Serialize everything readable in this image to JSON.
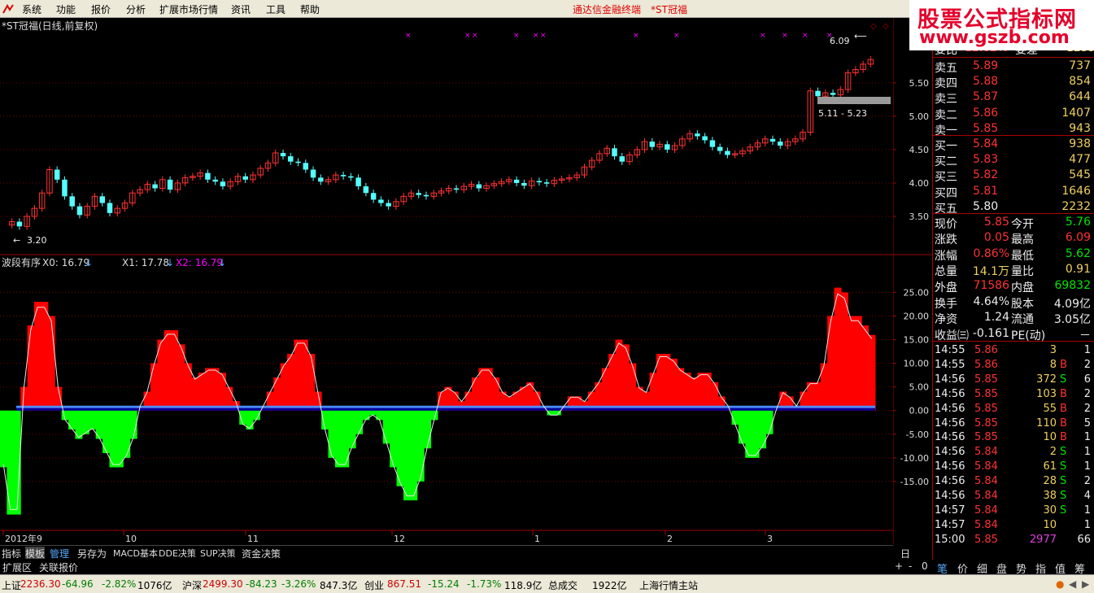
{
  "menu": {
    "items": [
      "系统",
      "功能",
      "报价",
      "分析",
      "扩展市场行情",
      "资讯",
      "工具",
      "帮助"
    ],
    "title_center": "通达信金融终端",
    "title_stock": "*ST冠福"
  },
  "watermark": {
    "line1": "股票公式指标网",
    "line2": "www.gszb.com"
  },
  "main_chart": {
    "title": "*ST冠福(日线,前复权)",
    "price_high_label": "6.09",
    "price_low_label": "3.20",
    "range_label": "5.11 - 5.23"
  },
  "indicator": {
    "name": "波段有序",
    "x0": "X0: 16.79",
    "x1": "X1: 17.78",
    "x2": "X2: 16.79"
  },
  "colors": {
    "up": "#ff3232",
    "down": "#54ffff",
    "pos_bar": "#ff0000",
    "neg_bar": "#00ff00",
    "x2": "#ff00ff"
  },
  "chart_data": [
    {
      "type": "candlestick",
      "title": "*ST冠福(日线,前复权)",
      "y_ticks": [
        "5.50",
        "5.00",
        "4.50",
        "4.00",
        "3.50"
      ],
      "ylim": [
        3.0,
        6.4
      ],
      "x_ticks": [
        "2012年9",
        "10",
        "11",
        "12",
        "1",
        "2",
        "3"
      ],
      "close": [
        3.42,
        3.35,
        3.5,
        3.62,
        3.85,
        4.2,
        4.05,
        3.8,
        3.65,
        3.52,
        3.65,
        3.8,
        3.7,
        3.55,
        3.62,
        3.7,
        3.85,
        3.9,
        3.98,
        3.92,
        4.05,
        3.9,
        4.0,
        4.08,
        4.1,
        4.15,
        4.05,
        4.02,
        3.95,
        4.02,
        4.1,
        4.05,
        4.12,
        4.22,
        4.3,
        4.45,
        4.4,
        4.32,
        4.3,
        4.2,
        4.08,
        4.02,
        4.05,
        4.12,
        4.1,
        4.08,
        3.95,
        3.85,
        3.75,
        3.7,
        3.65,
        3.72,
        3.8,
        3.85,
        3.82,
        3.8,
        3.85,
        3.88,
        3.92,
        3.9,
        3.95,
        3.98,
        3.92,
        3.96,
        3.99,
        4.02,
        4.05,
        4.0,
        3.96,
        4.03,
        4.01,
        3.99,
        4.04,
        4.06,
        4.08,
        4.12,
        4.24,
        4.34,
        4.44,
        4.52,
        4.4,
        4.32,
        4.42,
        4.5,
        4.62,
        4.54,
        4.58,
        4.5,
        4.56,
        4.66,
        4.74,
        4.7,
        4.64,
        4.54,
        4.48,
        4.42,
        4.44,
        4.48,
        4.54,
        4.6,
        4.66,
        4.62,
        4.56,
        4.62,
        4.66,
        4.76,
        5.38,
        5.3,
        5.35,
        5.32,
        5.4,
        5.65,
        5.7,
        5.78,
        5.85
      ],
      "y_label_high": "6.09",
      "y_label_low": "3.20"
    },
    {
      "type": "bar",
      "title": "波段有序",
      "y_ticks": [
        "25.00",
        "20.00",
        "15.00",
        "10.00",
        "5.00",
        "0.00",
        "-5.00",
        "-10.00",
        "-15.00"
      ],
      "ylim": [
        -25,
        28
      ],
      "values": [
        -12,
        -22,
        -22,
        5,
        18,
        23,
        23,
        20,
        5,
        -2,
        -4,
        -6,
        -5,
        -4,
        -6,
        -9,
        -12,
        -12,
        -10,
        -6,
        1,
        4,
        10,
        15,
        17,
        17,
        14,
        10,
        7,
        8,
        9,
        9,
        8,
        5,
        2,
        -3,
        -4,
        -2,
        1,
        4,
        7,
        10,
        12,
        15,
        15,
        12,
        4,
        -4,
        -10,
        -12,
        -12,
        -8,
        -5,
        -2,
        -1,
        -2,
        -7,
        -12,
        -16,
        -19,
        -19,
        -15,
        -8,
        -2,
        4,
        5,
        4,
        2,
        4,
        7,
        9,
        9,
        7,
        4,
        3,
        4,
        5,
        6,
        4,
        1,
        -1,
        -1,
        1,
        3,
        3,
        2,
        4,
        6,
        9,
        12,
        15,
        14,
        10,
        5,
        4,
        8,
        12,
        12,
        11,
        9,
        8,
        7,
        8,
        8,
        6,
        3,
        1,
        -3,
        -7,
        -10,
        -10,
        -8,
        -5,
        0,
        4,
        3,
        1,
        4,
        6,
        6,
        10,
        20,
        26,
        25,
        20,
        20,
        18,
        16
      ]
    }
  ],
  "quote": {
    "top": {
      "label1": "委比",
      "val1": "12.82%",
      "label2": "委差",
      "val2": "1235"
    },
    "asks": [
      {
        "label": "卖五",
        "price": "5.89",
        "vol": "737"
      },
      {
        "label": "卖四",
        "price": "5.88",
        "vol": "854"
      },
      {
        "label": "卖三",
        "price": "5.87",
        "vol": "644"
      },
      {
        "label": "卖二",
        "price": "5.86",
        "vol": "1407"
      },
      {
        "label": "卖一",
        "price": "5.85",
        "vol": "943"
      }
    ],
    "bids": [
      {
        "label": "买一",
        "price": "5.84",
        "vol": "938"
      },
      {
        "label": "买二",
        "price": "5.83",
        "vol": "477"
      },
      {
        "label": "买三",
        "price": "5.82",
        "vol": "545"
      },
      {
        "label": "买四",
        "price": "5.81",
        "vol": "1646"
      },
      {
        "label": "买五",
        "price": "5.80",
        "vol": "2232"
      }
    ],
    "stats": [
      {
        "l1": "现价",
        "v1": "5.85",
        "l2": "今开",
        "v2": "5.76",
        "c1": "red",
        "c2": "grn"
      },
      {
        "l1": "涨跌",
        "v1": "0.05",
        "l2": "最高",
        "v2": "6.09",
        "c1": "red",
        "c2": "red"
      },
      {
        "l1": "涨幅",
        "v1": "0.86%",
        "l2": "最低",
        "v2": "5.62",
        "c1": "red",
        "c2": "grn"
      },
      {
        "l1": "总量",
        "v1": "14.1万",
        "l2": "量比",
        "v2": "0.91",
        "c1": "yel",
        "c2": "yel"
      },
      {
        "l1": "外盘",
        "v1": "71586",
        "l2": "内盘",
        "v2": "69832",
        "c1": "red",
        "c2": "grn"
      },
      {
        "l1": "换手",
        "v1": "4.64%",
        "l2": "股本",
        "v2": "4.09亿",
        "c1": "wht",
        "c2": "wht"
      },
      {
        "l1": "净资",
        "v1": "1.24",
        "l2": "流通",
        "v2": "3.05亿",
        "c1": "wht",
        "c2": "wht"
      },
      {
        "l1": "收益㈢",
        "v1": "-0.161",
        "l2": "PE(动)",
        "v2": "－",
        "c1": "wht",
        "c2": "wht"
      }
    ],
    "ticks": [
      {
        "t": "14:55",
        "p": "5.86",
        "v": "3",
        "s": "",
        "n": "1"
      },
      {
        "t": "14:55",
        "p": "5.86",
        "v": "8",
        "s": "B",
        "n": "2"
      },
      {
        "t": "14:56",
        "p": "5.85",
        "v": "372",
        "s": "S",
        "n": "6"
      },
      {
        "t": "14:56",
        "p": "5.85",
        "v": "103",
        "s": "B",
        "n": "2"
      },
      {
        "t": "14:56",
        "p": "5.85",
        "v": "55",
        "s": "B",
        "n": "2"
      },
      {
        "t": "14:56",
        "p": "5.85",
        "v": "110",
        "s": "B",
        "n": "5"
      },
      {
        "t": "14:56",
        "p": "5.85",
        "v": "10",
        "s": "B",
        "n": "1"
      },
      {
        "t": "14:56",
        "p": "5.84",
        "v": "2",
        "s": "S",
        "n": "1"
      },
      {
        "t": "14:56",
        "p": "5.84",
        "v": "61",
        "s": "S",
        "n": "1"
      },
      {
        "t": "14:56",
        "p": "5.84",
        "v": "28",
        "s": "S",
        "n": "2"
      },
      {
        "t": "14:56",
        "p": "5.84",
        "v": "38",
        "s": "S",
        "n": "4"
      },
      {
        "t": "14:57",
        "p": "5.84",
        "v": "30",
        "s": "S",
        "n": "1"
      },
      {
        "t": "14:57",
        "p": "5.84",
        "v": "10",
        "s": "",
        "n": "1"
      },
      {
        "t": "15:00",
        "p": "5.85",
        "v": "2977",
        "s": "",
        "n": "66"
      }
    ]
  },
  "bottom_tabs": [
    "指标",
    "模板",
    "管理",
    "另存为",
    "MACD基本",
    "DDE决策",
    "SUP决策",
    "资金决策"
  ],
  "period_label": "日线",
  "ext_tabs": [
    "扩展区",
    "关联报价"
  ],
  "right_tabs": [
    "笔",
    "价",
    "细",
    "盘",
    "势",
    "指",
    "值",
    "筹"
  ],
  "status": {
    "sh_label": "上证",
    "sh_val": "2236.30",
    "sh_chg": "-64.96",
    "sh_pct": "-2.82%",
    "sh_amt": "1076亿",
    "sz_label": "沪深",
    "sz_val": "2499.30",
    "sz_chg": "-84.23",
    "sz_pct": "-3.26%",
    "sz_amt": "847.3亿",
    "cy_label": "创业",
    "cy_val": "867.51",
    "cy_chg": "-15.24",
    "cy_pct": "-1.73%",
    "cy_amt": "118.9亿",
    "total_label": "总成交",
    "total_val": "1922亿",
    "server": "上海行情主站"
  }
}
